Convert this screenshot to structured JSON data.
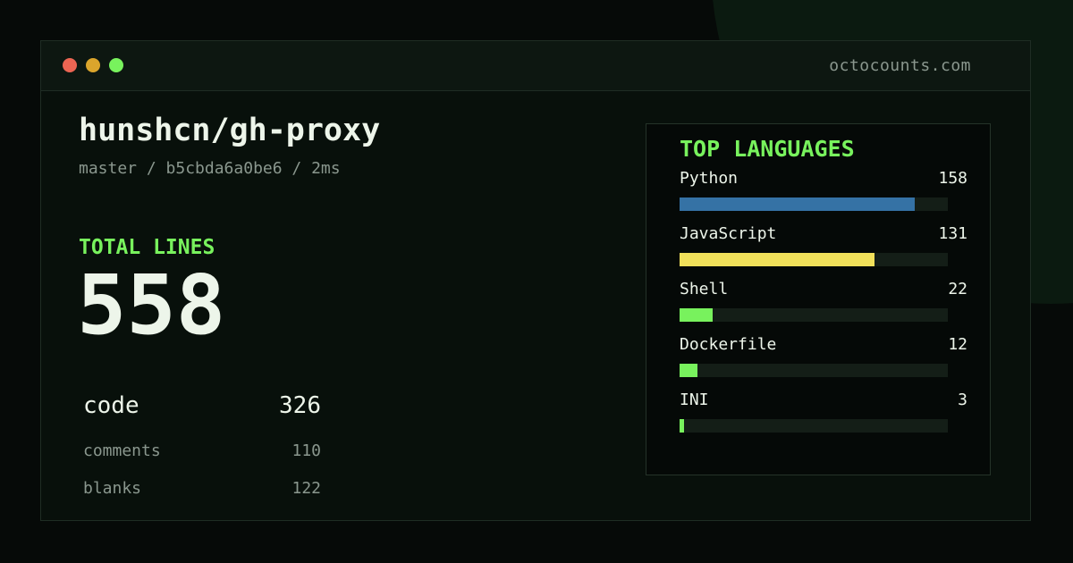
{
  "window": {
    "site": "octocounts.com",
    "controls": [
      "close",
      "minimize",
      "maximize"
    ]
  },
  "repo": {
    "name": "hunshcn/gh-proxy",
    "meta": "master / b5cbda6a0be6 / 2ms"
  },
  "totals": {
    "label": "TOTAL LINES",
    "value": "558"
  },
  "stats": [
    {
      "label": "code",
      "value": "326"
    },
    {
      "label": "comments",
      "value": "110"
    },
    {
      "label": "blanks",
      "value": "122"
    }
  ],
  "languages": {
    "title": "TOP LANGUAGES",
    "max": 180,
    "items": [
      {
        "name": "Python",
        "count": "158",
        "value": 158,
        "color": "#3572A5"
      },
      {
        "name": "JavaScript",
        "count": "131",
        "value": 131,
        "color": "#f1e05a"
      },
      {
        "name": "Shell",
        "count": "22",
        "value": 22,
        "color": "#78f25d"
      },
      {
        "name": "Dockerfile",
        "count": "12",
        "value": 12,
        "color": "#78f25d"
      },
      {
        "name": "INI",
        "count": "3",
        "value": 3,
        "color": "#78f25d"
      }
    ]
  }
}
